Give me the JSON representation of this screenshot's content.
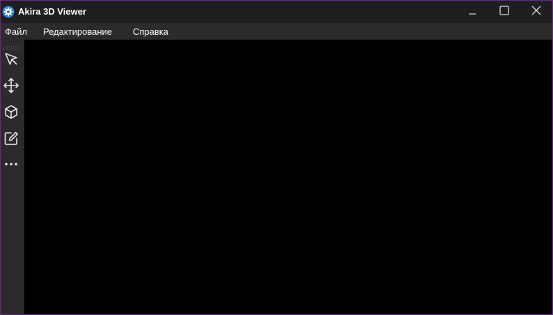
{
  "window": {
    "title": "Akira 3D Viewer",
    "app_icon": "gear-app-icon",
    "controls": [
      "minimize-icon",
      "maximize-icon",
      "close-icon"
    ]
  },
  "menubar": {
    "items": [
      "Файл",
      "Редактирование",
      "Справка"
    ]
  },
  "toolbar": {
    "tools": [
      "select-arrow-icon",
      "move-arrows-icon",
      "cube-icon",
      "edit-icon",
      "more-dots-icon"
    ]
  },
  "colors": {
    "titlebar": "#1f1f1f",
    "menubar": "#2b2b2b",
    "toolbar": "#2b2b2b",
    "viewport": "#000000",
    "accent_icon": "#2a7fd4",
    "window_border": "#6b2a86"
  }
}
